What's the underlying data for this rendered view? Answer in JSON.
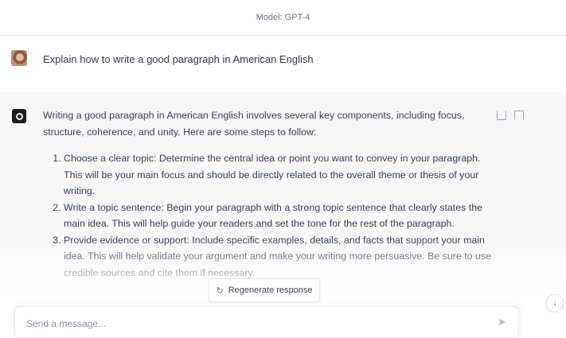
{
  "header": {
    "model_label": "Model: GPT-4"
  },
  "user_message": {
    "text": "Explain how to write a good paragraph in American English"
  },
  "assistant_message": {
    "intro": "Writing a good paragraph in American English involves several key components, including focus, structure, coherence, and unity. Here are some steps to follow:",
    "steps": [
      "Choose a clear topic: Determine the central idea or point you want to convey in your paragraph. This will be your main focus and should be directly related to the overall theme or thesis of your writing.",
      "Write a topic sentence: Begin your paragraph with a strong topic sentence that clearly states the main idea. This will help guide your readers and set the tone for the rest of the paragraph.",
      "Provide evidence or support: Include specific examples, details, and facts that support your main idea. This will help validate your argument and make your writing more persuasive. Be sure to use credible sources and cite them if necessary."
    ]
  },
  "regenerate": {
    "label": "Regenerate response"
  },
  "composer": {
    "placeholder": "Send a message..."
  },
  "icons": {
    "avatar": "user-avatar",
    "assistant": "openai-logo-icon",
    "thumb_up": "thumb-up-icon",
    "thumb_down": "thumb-down-icon",
    "regenerate": "refresh-icon",
    "scroll": "arrow-down-icon",
    "send": "send-icon"
  }
}
